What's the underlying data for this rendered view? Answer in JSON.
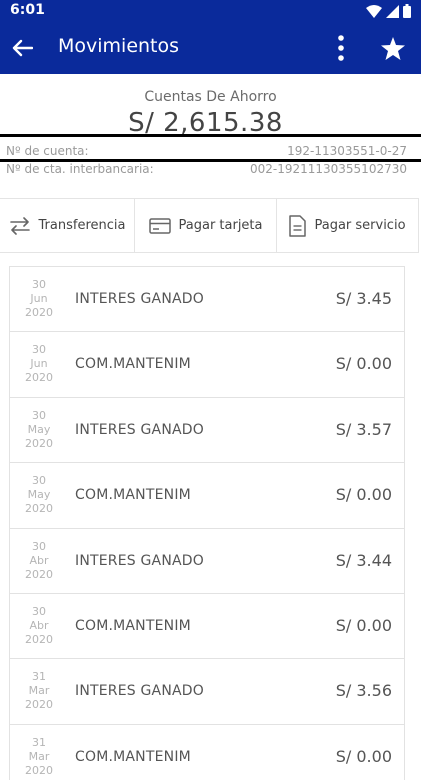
{
  "status": {
    "time": "6:01"
  },
  "header": {
    "title": "Movimientos"
  },
  "account": {
    "type": "Cuentas De Ahorro",
    "balance": "S/ 2,615.38",
    "number_label": "Nº de cuenta:",
    "number_value": "192-11303551-0-27",
    "cci_label": "Nº de cta. interbancaria:",
    "cci_value": "002-19211130355102730"
  },
  "actions": [
    {
      "label": "Transferencia",
      "icon": "transfer-icon"
    },
    {
      "label": "Pagar tarjeta",
      "icon": "card-icon"
    },
    {
      "label": "Pagar servicio",
      "icon": "document-icon"
    }
  ],
  "movements": [
    {
      "day": "30",
      "month": "Jun",
      "year": "2020",
      "description": "INTERES GANADO",
      "amount": "S/ 3.45"
    },
    {
      "day": "30",
      "month": "Jun",
      "year": "2020",
      "description": "COM.MANTENIM",
      "amount": "S/ 0.00"
    },
    {
      "day": "30",
      "month": "May",
      "year": "2020",
      "description": "INTERES GANADO",
      "amount": "S/ 3.57"
    },
    {
      "day": "30",
      "month": "May",
      "year": "2020",
      "description": "COM.MANTENIM",
      "amount": "S/ 0.00"
    },
    {
      "day": "30",
      "month": "Abr",
      "year": "2020",
      "description": "INTERES GANADO",
      "amount": "S/ 3.44"
    },
    {
      "day": "30",
      "month": "Abr",
      "year": "2020",
      "description": "COM.MANTENIM",
      "amount": "S/ 0.00"
    },
    {
      "day": "31",
      "month": "Mar",
      "year": "2020",
      "description": "INTERES GANADO",
      "amount": "S/ 3.56"
    },
    {
      "day": "31",
      "month": "Mar",
      "year": "2020",
      "description": "COM.MANTENIM",
      "amount": "S/ 0.00"
    }
  ],
  "colors": {
    "primary": "#0a2a9b",
    "text": "#555555",
    "muted": "#b5b5b5"
  }
}
